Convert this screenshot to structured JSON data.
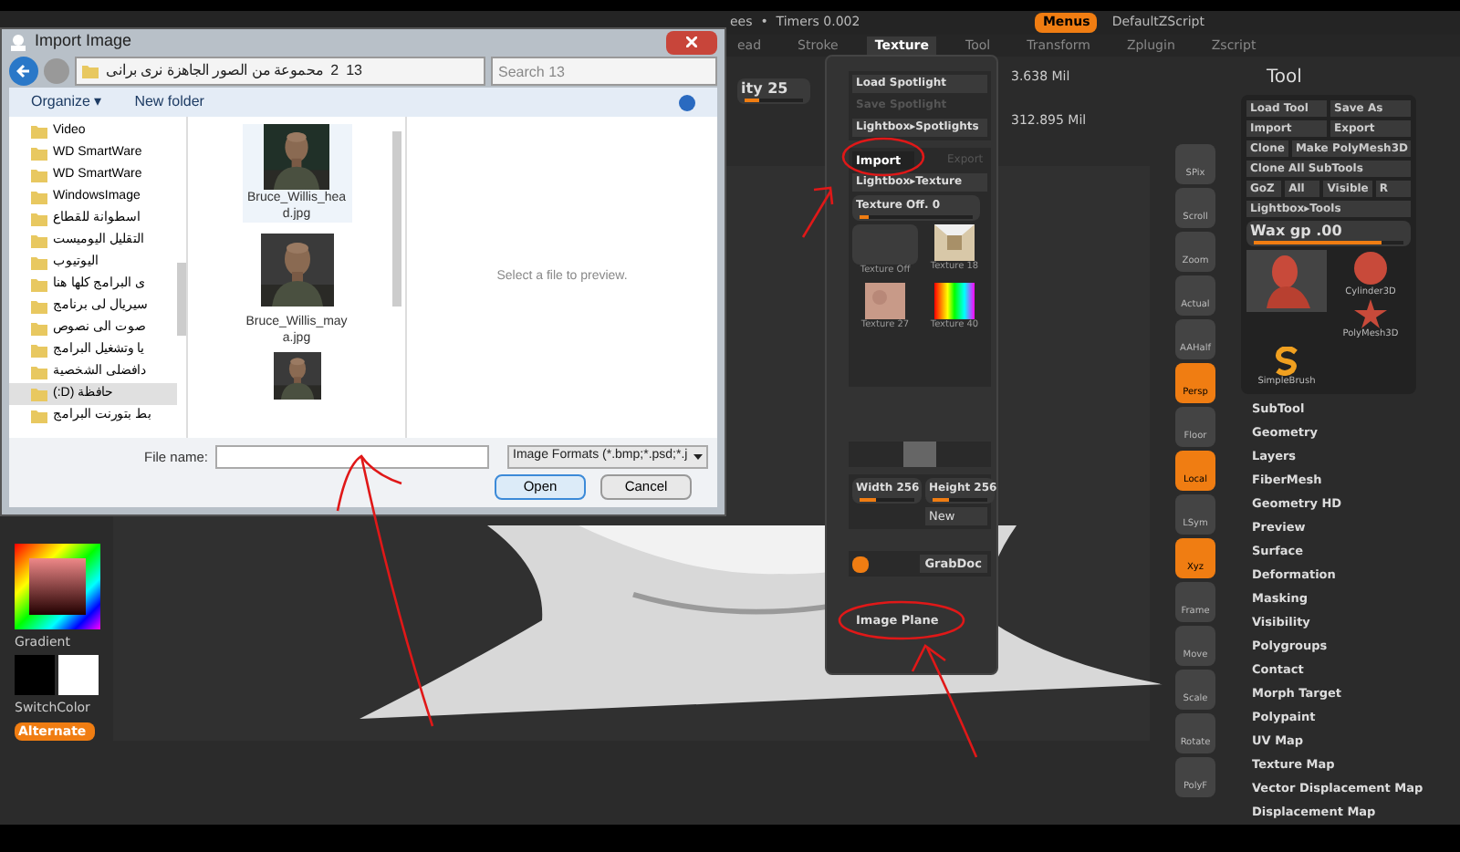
{
  "zbrush": {
    "top_bar": {
      "status": "ees  •  Timers 0.002",
      "menus_button": "Menus",
      "script": "DefaultZScript"
    },
    "menu_bar": [
      {
        "label": "ead",
        "selected": false
      },
      {
        "label": "Stroke",
        "selected": false
      },
      {
        "label": "Texture",
        "selected": true
      },
      {
        "label": "Tool",
        "selected": false
      },
      {
        "label": "Transform",
        "selected": false
      },
      {
        "label": "Zplugin",
        "selected": false
      },
      {
        "label": "Zscript",
        "selected": false
      }
    ],
    "readouts": [
      "3.638 Mil",
      "312.895 Mil"
    ],
    "intensity": {
      "label": "ity 25",
      "level": 0.25
    },
    "texture_popup": {
      "spotlight": [
        {
          "label": "Load Spotlight",
          "disabled": false
        },
        {
          "label": "Save Spotlight",
          "disabled": true
        },
        {
          "label": "Lightbox▸Spotlights",
          "disabled": false
        }
      ],
      "import": {
        "label": "Import"
      },
      "export": {
        "label": "Export"
      },
      "lightbox": "Lightbox▸Texture",
      "texture_slider": {
        "label": "Texture Off. 0",
        "level": 0.08
      },
      "thumbnails": [
        {
          "label": "Texture Off",
          "kind": "blank"
        },
        {
          "label": "Texture 18",
          "kind": "room"
        },
        {
          "label": "Texture 27",
          "kind": "skin"
        },
        {
          "label": "Texture 40",
          "kind": "spectrum"
        }
      ],
      "width": {
        "label": "Width 256",
        "level": 0.3
      },
      "height": {
        "label": "Height 256",
        "level": 0.3
      },
      "new_button": "New",
      "grabdoc": "GrabDoc",
      "image_plane": "Image Plane"
    },
    "left_panel": {
      "gradient": "Gradient",
      "switch_color": "SwitchColor",
      "alternate": "Alternate"
    },
    "shelf": [
      {
        "label": "SPix",
        "active": false
      },
      {
        "label": "Scroll",
        "active": false
      },
      {
        "label": "Zoom",
        "active": false
      },
      {
        "label": "Actual",
        "active": false
      },
      {
        "label": "AAHalf",
        "active": false
      },
      {
        "label": "Persp",
        "active": true
      },
      {
        "label": "Floor",
        "active": false
      },
      {
        "label": "Local",
        "active": true
      },
      {
        "label": "LSym",
        "active": false
      },
      {
        "label": "Xyz",
        "active": true
      },
      {
        "label": "Frame",
        "active": false
      },
      {
        "label": "Move",
        "active": false
      },
      {
        "label": "Scale",
        "active": false
      },
      {
        "label": "Rotate",
        "active": false
      },
      {
        "label": "PolyF",
        "active": false
      }
    ],
    "tool_panel": {
      "title": "Tool",
      "buttons": [
        [
          "Load Tool",
          "Save As"
        ],
        [
          "Import",
          "Export"
        ],
        [
          "Clone",
          "Make PolyMesh3D"
        ],
        [
          "Clone All SubTools"
        ],
        [
          "GoZ",
          "All",
          "Visible",
          "R"
        ],
        [
          "Lightbox▸Tools"
        ]
      ],
      "slider": {
        "label": "Wax gp .00",
        "level": 0.85
      },
      "tools": [
        {
          "label": "Cylinder3D",
          "kind": "cylinder"
        },
        {
          "label": "PolyMesh3D",
          "kind": "star"
        },
        {
          "label": "SimpleBrush",
          "kind": "brush"
        }
      ],
      "sections": [
        "SubTool",
        "Geometry",
        "Layers",
        "FiberMesh",
        "Geometry HD",
        "Preview",
        "Surface",
        "Deformation",
        "Masking",
        "Visibility",
        "Polygroups",
        "Contact",
        "Morph Target",
        "Polypaint",
        "UV Map",
        "Texture Map",
        "Vector Displacement Map",
        "Displacement Map"
      ]
    }
  },
  "dialog": {
    "title": "Import Image",
    "breadcrumb": [
      "محموعة من الصور الجاهزة نرى برانى",
      "2",
      "13"
    ],
    "search": {
      "placeholder": "Search 13"
    },
    "toolbar": [
      "Organize ▾",
      "New folder"
    ],
    "folders": [
      {
        "label": "Video",
        "selected": false
      },
      {
        "label": "WD SmartWare",
        "selected": false
      },
      {
        "label": "WD SmartWare",
        "selected": false
      },
      {
        "label": "WindowsImage",
        "selected": false
      },
      {
        "label": "اسطوانة للقطاع",
        "selected": false
      },
      {
        "label": "التقليل اليوميست",
        "selected": false
      },
      {
        "label": "اليوتيوب",
        "selected": false
      },
      {
        "label": "ى البرامج كلها هنا",
        "selected": false
      },
      {
        "label": "سيريال لى برنامج",
        "selected": false
      },
      {
        "label": "صوت الى نصوص",
        "selected": false
      },
      {
        "label": "يا وتشغيل البرامج",
        "selected": false
      },
      {
        "label": "دافضلى الشخصية",
        "selected": false
      },
      {
        "label": "حافظة (D:)",
        "selected": true
      },
      {
        "label": "بط بتورنت البرامج",
        "selected": false
      }
    ],
    "files": [
      {
        "label": "Bruce_Willis_hea d.jpg",
        "selected": true
      },
      {
        "label": "Bruce_Willis_may a.jpg",
        "selected": false
      },
      {
        "selected": false
      }
    ],
    "preview": "Select a file to preview.",
    "file_name_label": "File name:",
    "filter": "Image Formats (*.bmp;*.psd;*.j",
    "open": "Open",
    "cancel": "Cancel"
  }
}
